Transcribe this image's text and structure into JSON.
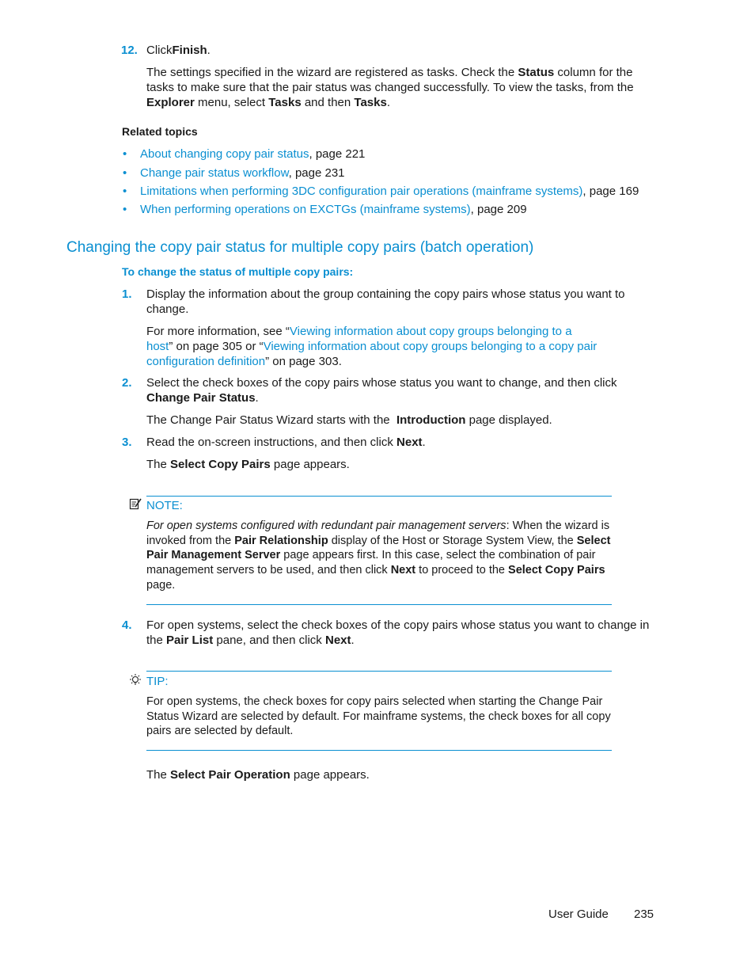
{
  "step12": {
    "number": "12.",
    "click": "Click",
    "finish": "Finish",
    "period": ".",
    "para": {
      "t1": "The settings specified in the wizard are registered as tasks. Check the ",
      "status": "Status",
      "t2": " column for the tasks to make sure that the pair status was changed successfully. To view the tasks, from the ",
      "explorer": "Explorer",
      "t3": " menu, select ",
      "tasks1": "Tasks",
      "t4": " and then ",
      "tasks2": "Tasks",
      "t5": "."
    }
  },
  "related": {
    "heading": "Related topics",
    "items": [
      {
        "link": "About changing copy pair status",
        "suffix": ", page 221"
      },
      {
        "link": "Change pair status workflow",
        "suffix": ", page 231"
      },
      {
        "link": "Limitations when performing 3DC configuration pair operations (mainframe systems)",
        "suffix": ", page 169"
      },
      {
        "link": "When performing operations on EXCTGs (mainframe systems)",
        "suffix": ", page 209"
      }
    ]
  },
  "section": {
    "title": "Changing the copy pair status for multiple copy pairs (batch operation)",
    "procedure": "To change the status of multiple copy pairs:"
  },
  "steps": {
    "s1": {
      "number": "1.",
      "text": "Display the information about the group containing the copy pairs whose status you want to change.",
      "more_prefix": "For more information, see “",
      "link1a": "Viewing information about copy groups belonging to a",
      "link1b": "host",
      "mid": "” on page 305 or “",
      "link2a": "Viewing information about copy groups belonging to a copy pair",
      "link2b": "configuration definition",
      "suffix": "” on page 303."
    },
    "s2": {
      "number": "2.",
      "t1": "Select the check boxes of the copy pairs whose status you want to change, and then click ",
      "b1": "Change Pair Status",
      "t2": ".",
      "note_t1": "The Change Pair Status Wizard starts with the  ",
      "note_b": "Introduction",
      "note_t2": " page displayed."
    },
    "s3": {
      "number": "3.",
      "t1": "Read the on-screen instructions, and then click ",
      "b1": "Next",
      "t2": ".",
      "r1": "The ",
      "rb": "Select Copy Pairs",
      "r2": " page appears."
    },
    "s4": {
      "number": "4.",
      "t1": "For open systems, select the check boxes of the copy pairs whose status you want to change in the ",
      "b1": "Pair List",
      "t2": " pane, and then click ",
      "b2": "Next",
      "t3": ".",
      "r1": "The ",
      "rb": "Select Pair Operation",
      "r2": " page appears."
    }
  },
  "note": {
    "label": "NOTE:",
    "icon": "note-pencil-icon",
    "italic": "For open systems configured with redundant pair management servers",
    "t1": ": When the wizard is invoked from the ",
    "b1": "Pair Relationship",
    "t2": " display of the Host or Storage System View, the ",
    "b2": "Select Pair Management Server",
    "t3": " page appears first. In this case, select the combination of pair management servers to be used, and then click ",
    "b3": "Next",
    "t4": " to proceed to the ",
    "b4": "Select Copy Pairs",
    "t5": " page."
  },
  "tip": {
    "label": "TIP:",
    "icon": "lightbulb-icon",
    "text": "For open systems, the check boxes for copy pairs selected when starting the Change Pair Status Wizard are selected by default. For mainframe systems, the check boxes for all copy pairs are selected by default."
  },
  "footer": {
    "guide": "User Guide",
    "page": "235"
  },
  "colors": {
    "accent": "#0a8fd1",
    "text": "#1a1a1a"
  }
}
